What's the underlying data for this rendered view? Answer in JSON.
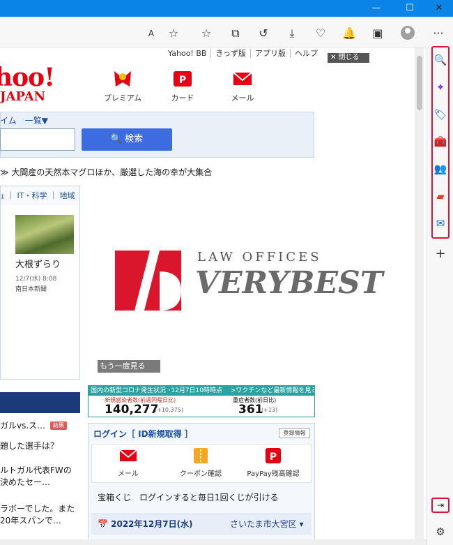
{
  "titlebar": {
    "minimize_glyph": "—",
    "maximize_glyph": "☐",
    "close_glyph": "✕"
  },
  "toolbar": {
    "icons": [
      "read-aloud-icon",
      "favorite-add-icon",
      "favorites-icon",
      "collections-icon",
      "history-icon",
      "downloads-icon",
      "performance-icon",
      "notifications-icon",
      "screenshot-icon",
      "profile-avatar",
      "more-icon"
    ],
    "read_aloud": "A",
    "more": "···"
  },
  "page": {
    "top_links": [
      "Yahoo! BB",
      "きっず版",
      "アプリ版",
      "ヘルプ"
    ],
    "logo_big": "hoo!",
    "logo_jp": "JAPAN",
    "services": [
      "プレミアム",
      "カード",
      "メール"
    ],
    "search_tabs": "イム　一覧▼",
    "search_button": "🔍 検索",
    "promo": "≫ 大間産の天然本マグロほか、厳選した海の幸が大集合",
    "nav": "ｪ  ｜ IT・科学 ｜ 地域",
    "news": {
      "title": "大根ずらり",
      "date": "12/7(水) 8:08",
      "source": "南日本新聞"
    },
    "ad": {
      "law": "LAW OFFICES",
      "name": "VERYBEST",
      "replay": "もう一度見る",
      "close": "✕ 閉じる"
    },
    "corona": {
      "header": "国内の新型コロナ発生状況 ･12月7日10時時点　 >ワクチンなど最新情報を見る",
      "label1": "新規感染者数(前週同曜日比)",
      "value1": "140,277",
      "delta1": "(+10,375)",
      "label2": "重症者数(前日比)",
      "value2": "361",
      "delta2": "(+13)"
    },
    "left_items": [
      "ガルvs.ス…",
      "題した選手は？",
      "ルトガル代表FWの",
      "決めたセー…",
      "ラボーでした。また",
      "20年スパンで…"
    ],
    "badge": "結果",
    "login": {
      "title": "ログイン［ ID新規取得 ］",
      "info": "登録情報",
      "items": [
        "メール",
        "クーポン確認",
        "PayPay残高確認"
      ],
      "lottery": "宝箱くじ　ログインすると毎日1回くじが引ける",
      "weather_date": "📅 2022年12月7日(水)",
      "weather_loc": "さいたま市大宮区 ▾"
    }
  },
  "sidebar": {
    "icons": [
      "search-icon",
      "discover-icon",
      "shopping-icon",
      "tools-icon",
      "games-icon",
      "office-icon",
      "outlook-icon"
    ],
    "add": "+",
    "hide": "⇥",
    "settings": "⚙"
  },
  "colors": {
    "titlebar": "#0a84e6",
    "accent_red": "#d9163a",
    "yahoo_red": "#e60012",
    "search_blue": "#3c6ce0"
  }
}
